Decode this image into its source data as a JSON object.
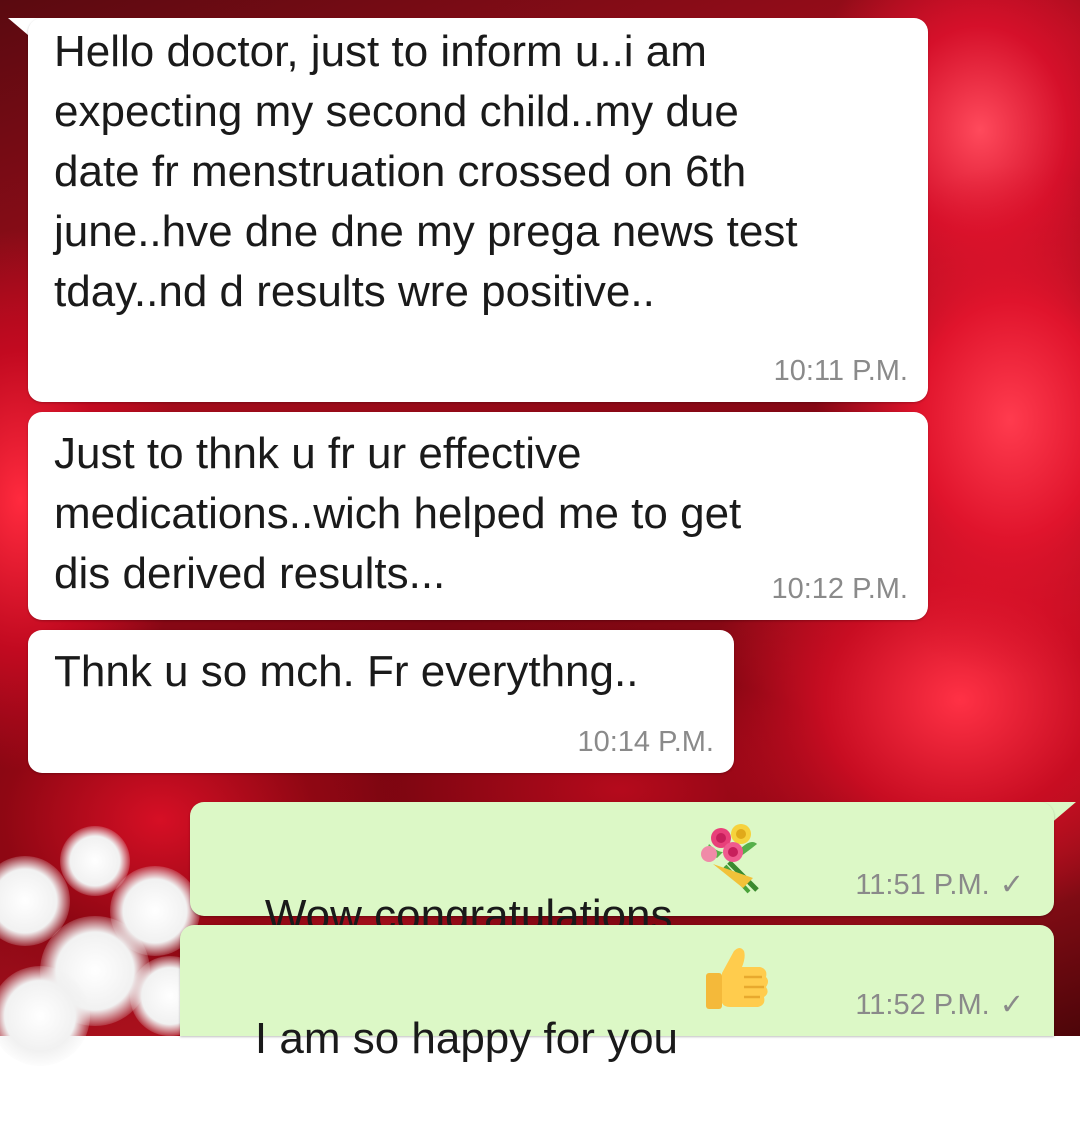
{
  "messages": [
    {
      "direction": "incoming",
      "text": "Hello doctor, just to inform u..i am\nexpecting my second child..my due\ndate fr menstruation crossed on 6th\njune..hve dne dne my prega news test\ntday..nd d results wre positive..",
      "time": "10:11 P.M."
    },
    {
      "direction": "incoming",
      "text": "Just to thnk u fr ur effective\nmedications..wich helped me to get\ndis derived results...",
      "time": "10:12 P.M."
    },
    {
      "direction": "incoming",
      "text": "Thnk u so mch. Fr everythng..",
      "time": "10:14 P.M."
    },
    {
      "direction": "outgoing",
      "text": "Wow congratulations",
      "emoji": "bouquet-emoji",
      "time": "11:51 P.M.",
      "status": "✓"
    },
    {
      "direction": "outgoing",
      "text": "I am so happy for you",
      "emoji": "thumbs-up-emoji",
      "time": "11:52 P.M.",
      "status": "✓"
    }
  ],
  "colors": {
    "incoming_bubble": "#ffffff",
    "outgoing_bubble": "#dcf8c6",
    "timestamp": "#8a8a8a",
    "text": "#1a1a1a"
  }
}
